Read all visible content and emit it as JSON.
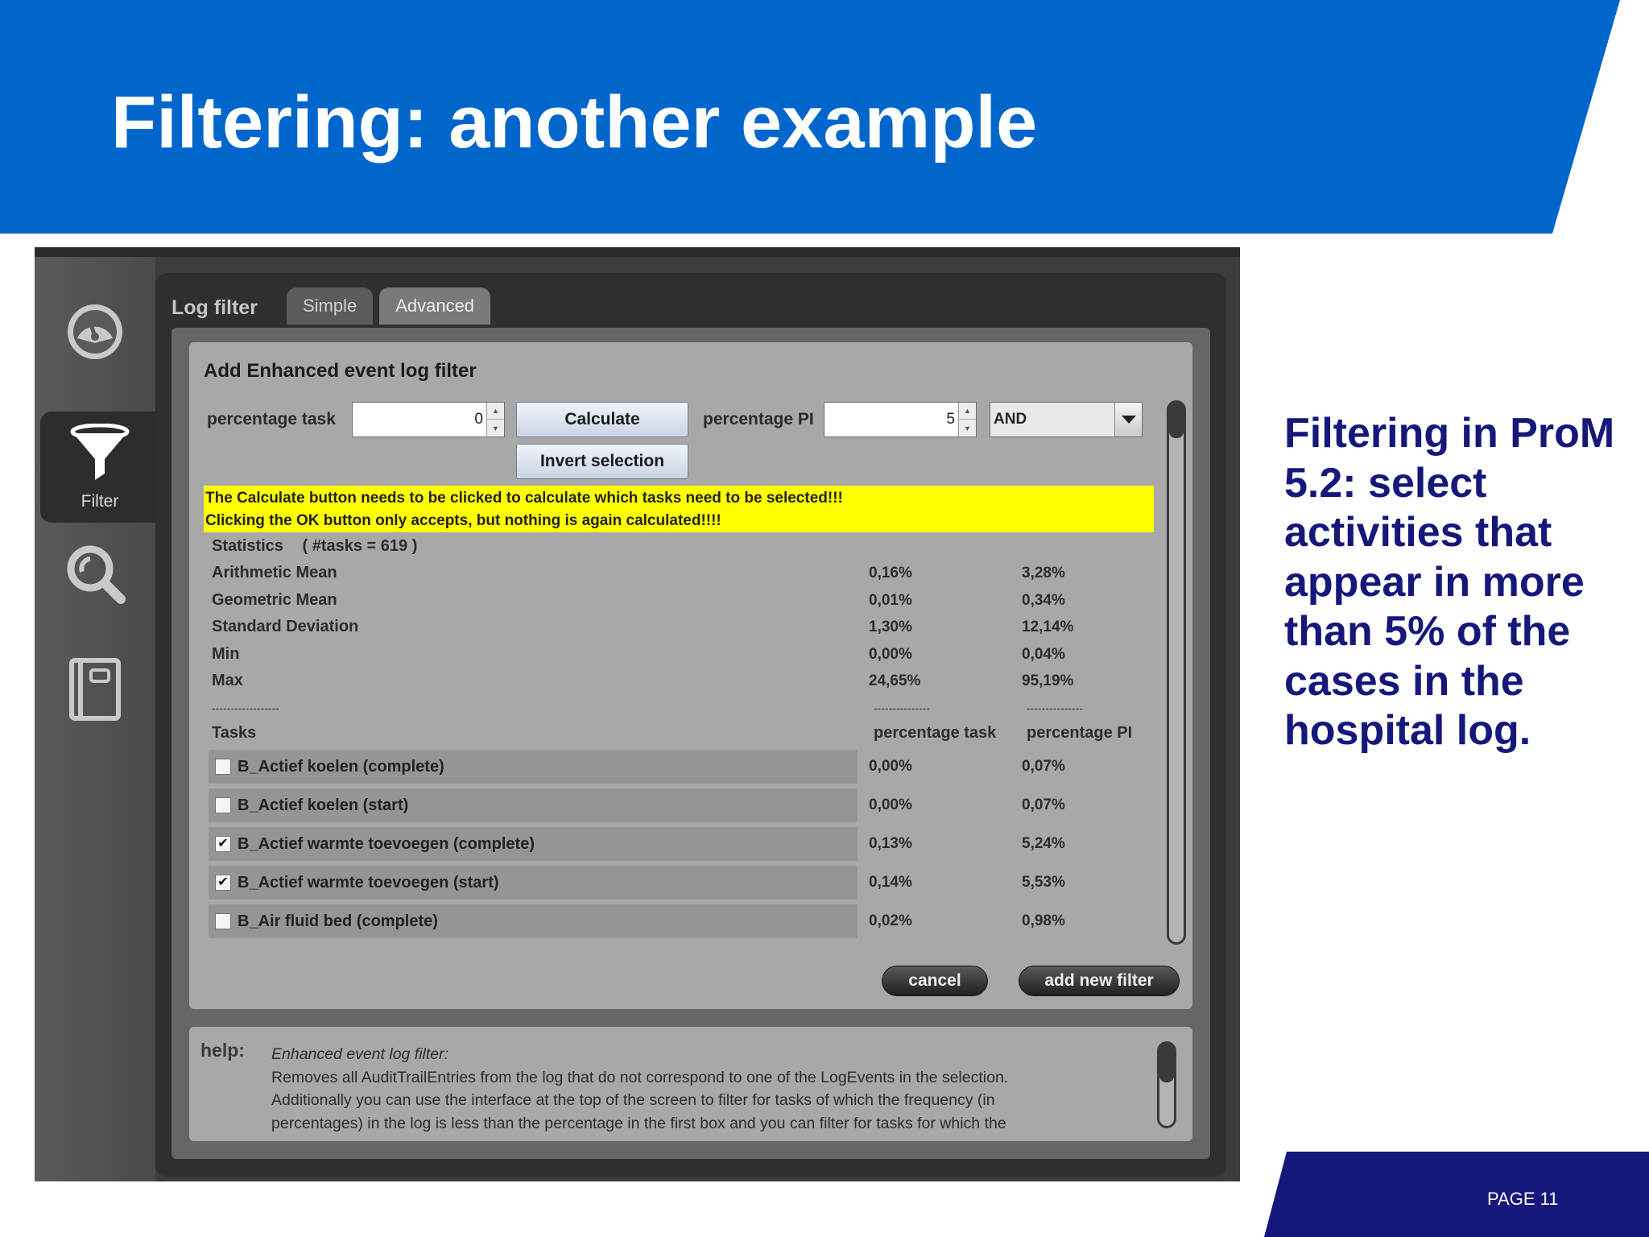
{
  "slide": {
    "title": "Filtering: another example",
    "side_text": "Filtering in ProM 5.2: select activities that appear in more than 5% of the cases in the hospital log.",
    "page_number": "PAGE 11",
    "colors": {
      "header_blue": "#0066cc",
      "footer_navy": "#15177a",
      "side_text": "#15177a"
    }
  },
  "app": {
    "sidebar": {
      "items": [
        {
          "icon": "dashboard-gauge-icon",
          "label": ""
        },
        {
          "icon": "funnel-filter-icon",
          "label": "Filter",
          "active": true
        },
        {
          "icon": "magnifier-icon",
          "label": ""
        },
        {
          "icon": "notebook-icon",
          "label": ""
        }
      ]
    },
    "tabs": {
      "header": "Log filter",
      "items": [
        "Simple",
        "Advanced"
      ],
      "active": "Advanced"
    },
    "filter": {
      "title": "Add Enhanced event log filter",
      "percentage_task_label": "percentage task",
      "percentage_task_value": "0",
      "calculate_label": "Calculate",
      "invert_label": "Invert selection",
      "percentage_pi_label": "percentage PI",
      "percentage_pi_value": "5",
      "combo_value": "AND",
      "warning_line1": "The Calculate button needs to be clicked to calculate which tasks need to be selected!!!",
      "warning_line2": "Clicking the OK button only accepts, but nothing is again calculated!!!!",
      "statistics_label": "Statistics",
      "tasks_count": "( #tasks = 619 )",
      "stats": [
        {
          "name": "Arithmetic Mean",
          "task": "0,16%",
          "pi": "3,28%"
        },
        {
          "name": "Geometric Mean",
          "task": "0,01%",
          "pi": "0,34%"
        },
        {
          "name": "Standard Deviation",
          "task": "1,30%",
          "pi": "12,14%"
        },
        {
          "name": "Min",
          "task": "0,00%",
          "pi": "0,04%"
        },
        {
          "name": "Max",
          "task": "24,65%",
          "pi": "95,19%"
        }
      ],
      "dashes_left": "------------------",
      "dashes_mid": "---------------",
      "dashes_right": "---------------",
      "tasks_label": "Tasks",
      "col_task": "percentage task",
      "col_pi": "percentage PI",
      "tasks": [
        {
          "name": "B_Actief koelen (complete)",
          "checked": false,
          "task": "0,00%",
          "pi": "0,07%"
        },
        {
          "name": "B_Actief koelen (start)",
          "checked": false,
          "task": "0,00%",
          "pi": "0,07%"
        },
        {
          "name": "B_Actief warmte toevoegen (complete)",
          "checked": true,
          "task": "0,13%",
          "pi": "5,24%"
        },
        {
          "name": "B_Actief warmte toevoegen (start)",
          "checked": true,
          "task": "0,14%",
          "pi": "5,53%"
        },
        {
          "name": "B_Air fluid bed (complete)",
          "checked": false,
          "task": "0,02%",
          "pi": "0,98%"
        }
      ],
      "cancel_label": "cancel",
      "add_label": "add new filter"
    },
    "help": {
      "label": "help:",
      "title": "Enhanced event log filter:",
      "line1": "Removes all AuditTrailEntries from the log that do not correspond to one of the LogEvents in the selection.",
      "line2": "Additionally you can use the interface at the top of the screen to filter for tasks of which the frequency (in",
      "line3": "percentages) in the log is less than the percentage in the first box and you can filter for tasks for which the"
    }
  }
}
